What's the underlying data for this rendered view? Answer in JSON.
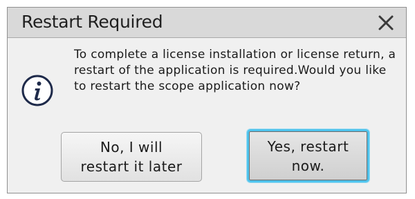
{
  "dialog": {
    "title": "Restart Required",
    "close_icon": "close-icon",
    "info_icon": "info-icon",
    "message": "To complete a license installation or license return, a restart of the application is required.Would you like to restart the scope application now?",
    "buttons": {
      "no_label": "No, I will\nrestart it later",
      "yes_label": "Yes, restart\nnow."
    },
    "colors": {
      "focus_ring": "#4fc3ec",
      "titlebar": "#d9d9d9",
      "body": "#f0f0f0"
    }
  }
}
